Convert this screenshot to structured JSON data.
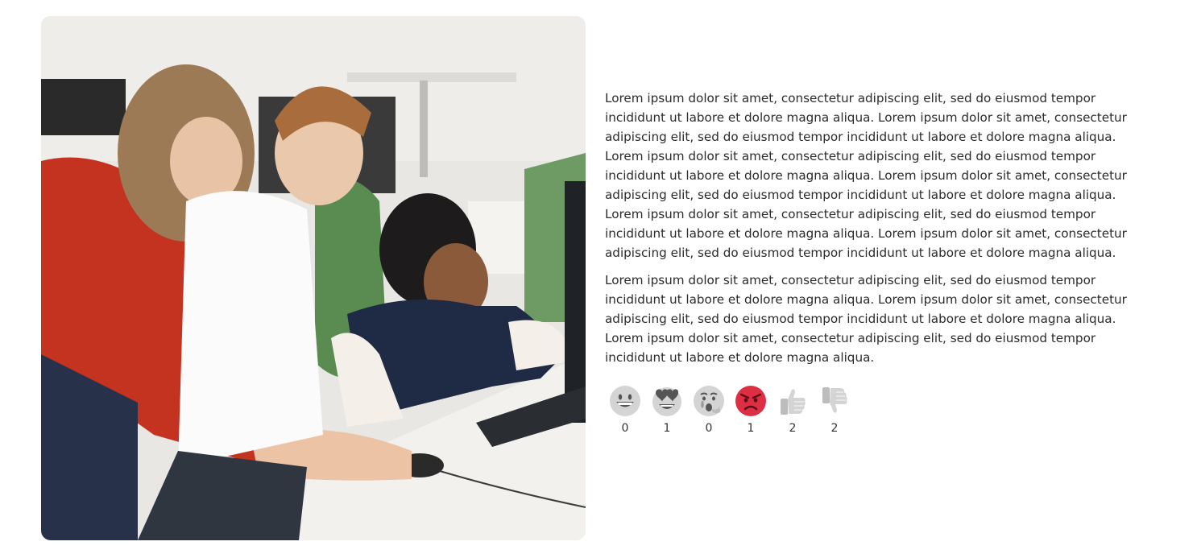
{
  "article": {
    "paragraphs": [
      "Lorem ipsum dolor sit amet, consectetur adipiscing elit, sed do eiusmod tempor incididunt ut labore et dolore magna aliqua. Lorem ipsum dolor sit amet, consectetur adipiscing elit, sed do eiusmod tempor incididunt ut labore et dolore magna aliqua. Lorem ipsum dolor sit amet, consectetur adipiscing elit, sed do eiusmod tempor incididunt ut labore et dolore magna aliqua. Lorem ipsum dolor sit amet, consectetur adipiscing elit, sed do eiusmod tempor incididunt ut labore et dolore magna aliqua. Lorem ipsum dolor sit amet, consectetur adipiscing elit, sed do eiusmod tempor incididunt ut labore et dolore magna aliqua. Lorem ipsum dolor sit amet, consectetur adipiscing elit, sed do eiusmod tempor incididunt ut labore et dolore magna aliqua.",
      "Lorem ipsum dolor sit amet, consectetur adipiscing elit, sed do eiusmod tempor incididunt ut labore et dolore magna aliqua. Lorem ipsum dolor sit amet, consectetur adipiscing elit, sed do eiusmod tempor incididunt ut labore et dolore magna aliqua. Lorem ipsum dolor sit amet, consectetur adipiscing elit, sed do eiusmod tempor incididunt ut labore et dolore magna aliqua."
    ]
  },
  "reactions": [
    {
      "icon": "grinning-face-icon",
      "count": "0",
      "color": "#d4d4d4"
    },
    {
      "icon": "heart-eyes-face-icon",
      "count": "1",
      "color": "#d4d4d4"
    },
    {
      "icon": "crying-face-icon",
      "count": "0",
      "color": "#d4d4d4"
    },
    {
      "icon": "angry-face-icon",
      "count": "1",
      "color": "#dd2e44"
    },
    {
      "icon": "thumbs-up-icon",
      "count": "2",
      "color": "#d4d4d4"
    },
    {
      "icon": "thumbs-down-icon",
      "count": "2",
      "color": "#d4d4d4"
    }
  ],
  "colors": {
    "inactive": "#d4d4d4",
    "angry": "#dd2e44"
  }
}
